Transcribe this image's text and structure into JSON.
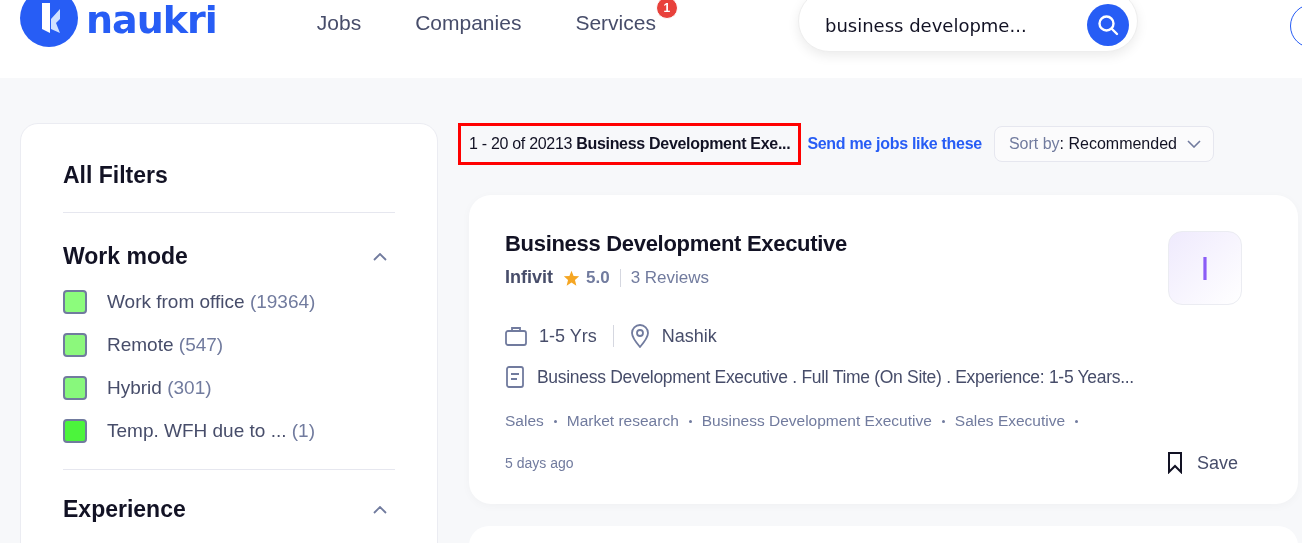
{
  "header": {
    "logo_text": "naukri",
    "nav": [
      {
        "label": "Jobs"
      },
      {
        "label": "Companies"
      },
      {
        "label": "Services",
        "badge": "1"
      }
    ],
    "search": {
      "value": "business developme..."
    }
  },
  "filters": {
    "title": "All Filters",
    "sections": [
      {
        "title": "Work mode",
        "expanded": true,
        "options": [
          {
            "label": "Work from office",
            "count": "(19364)",
            "checked": false,
            "color": "#8cfc7c"
          },
          {
            "label": "Remote",
            "count": "(547)",
            "checked": false,
            "color": "#8cf87c"
          },
          {
            "label": "Hybrid",
            "count": "(301)",
            "checked": false,
            "color": "#88f87c"
          },
          {
            "label": "Temp. WFH due to ...",
            "count": "(1)",
            "checked": false,
            "color": "#4cf43c"
          }
        ]
      },
      {
        "title": "Experience",
        "expanded": true
      }
    ]
  },
  "results": {
    "range": "1 - 20 of 20213",
    "query": "Business Development Exe...",
    "highlighted": true,
    "alert_link": "Send me jobs like these",
    "sort": {
      "label": "Sort by",
      "value": ": Recommended"
    }
  },
  "jobs": [
    {
      "title": "Business Development Executive",
      "company": "Infivit",
      "rating": "5.0",
      "reviews": "3 Reviews",
      "logo_letter": "I",
      "experience": "1-5 Yrs",
      "location": "Nashik",
      "description": "Business Development Executive . Full Time (On Site) . Experience: 1-5 Years...",
      "tags": [
        "Sales",
        "Market research",
        "Business Development Executive",
        "Sales Executive"
      ],
      "posted": "5 days ago",
      "save": "Save"
    }
  ]
}
